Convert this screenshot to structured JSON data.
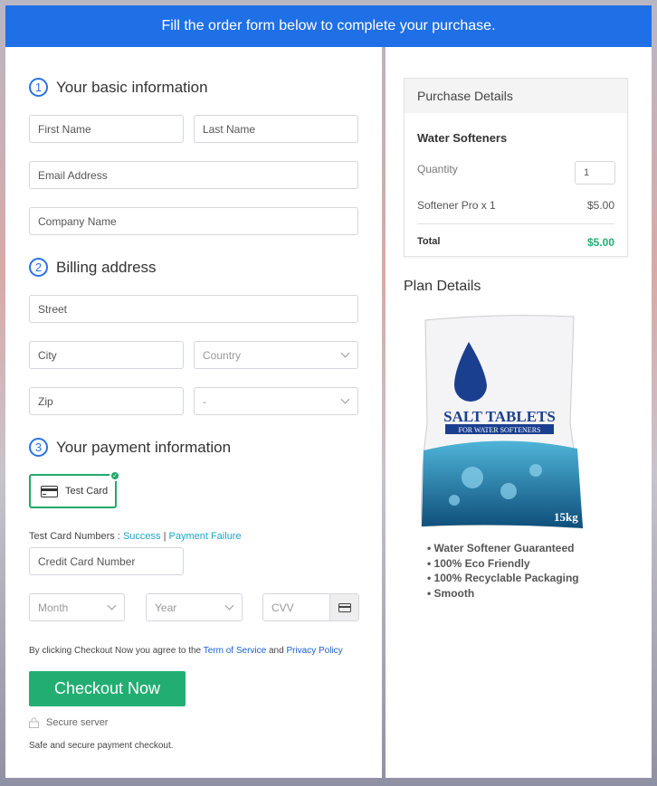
{
  "header": {
    "title": "Fill the order form below to complete your purchase."
  },
  "basic": {
    "number": "1",
    "title": "Your basic information",
    "first_name": "First Name",
    "last_name": "Last Name",
    "email": "Email Address",
    "company": "Company Name"
  },
  "billing": {
    "number": "2",
    "title": "Billing address",
    "street": "Street",
    "city": "City",
    "country": "Country",
    "zip": "Zip",
    "state": "-"
  },
  "payment": {
    "number": "3",
    "title": "Your payment information",
    "card_option": "Test Card",
    "test_numbers_label": "Test Card Numbers :",
    "success": "Success",
    "separator": "|",
    "failure": "Payment Failure",
    "card_number": "Credit Card Number",
    "month": "Month",
    "year": "Year",
    "cvv": "CVV",
    "agree_prefix": "By clicking Checkout Now you agree to the",
    "terms": "Term of Service",
    "and": "and",
    "privacy": "Privacy Policy",
    "checkout": "Checkout Now",
    "secure": "Secure server",
    "safe": "Safe and secure payment checkout."
  },
  "purchase": {
    "title": "Purchase Details",
    "product": "Water Softeners",
    "quantity_label": "Quantity",
    "quantity": "1",
    "line_item": "Softener Pro x 1",
    "line_price": "$5.00",
    "total_label": "Total",
    "total": "$5.00"
  },
  "plan": {
    "title": "Plan Details",
    "image_text": "SALT TABLETS",
    "image_subtext": "FOR WATER SOFTENERS",
    "image_weight": "15kg",
    "features": [
      "Water Softener Guaranteed",
      "100% Eco Friendly",
      "100% Recyclable Packaging",
      "Smooth"
    ]
  },
  "colors": {
    "header": "#1f6fe6",
    "accent": "#2a72e6",
    "success": "#22ae72",
    "link": "#1b5fd3"
  }
}
